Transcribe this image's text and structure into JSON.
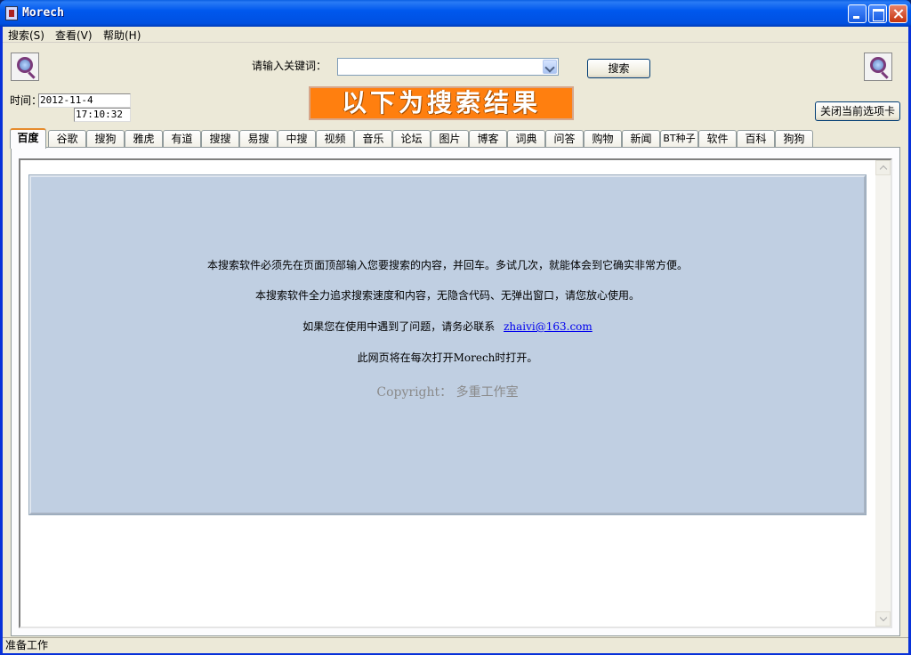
{
  "window": {
    "title": "Morech"
  },
  "menu": {
    "items": [
      "搜索(S)",
      "查看(V)",
      "帮助(H)"
    ]
  },
  "toolbar": {
    "keyword_label": "请输入关键词：",
    "keyword_value": "",
    "search_button": "搜索",
    "banner_text": "以下为搜索结果",
    "close_tab_button": "关闭当前选项卡"
  },
  "time": {
    "label": "时间：",
    "date": "2012-11-4",
    "clock": "17:10:32"
  },
  "tabs": [
    "百度",
    "谷歌",
    "搜狗",
    "雅虎",
    "有道",
    "搜搜",
    "易搜",
    "中搜",
    "视频",
    "音乐",
    "论坛",
    "图片",
    "博客",
    "词典",
    "问答",
    "购物",
    "新闻",
    "BT种子",
    "软件",
    "百科",
    "狗狗"
  ],
  "active_tab": "百度",
  "content": {
    "line1": "本搜索软件必须先在页面顶部输入您要搜索的内容，并回车。多试几次，就能体会到它确实非常方便。",
    "line2": "本搜索软件全力追求搜索速度和内容，无隐含代码、无弹出窗口，请您放心使用。",
    "line3_prefix": "如果您在使用中遇到了问题，请务必联系",
    "contact_email": "zhaivi@163.com",
    "line4": "此网页将在每次打开Morech时打开。",
    "copyright": "Copyright：   多重工作室"
  },
  "status": {
    "text": "准备工作"
  },
  "colors": {
    "banner": "#ff7f0f",
    "info_bg": "#c0cfe2",
    "titlebar": "#0058ee",
    "active_tab_accent": "#e68b2c"
  }
}
